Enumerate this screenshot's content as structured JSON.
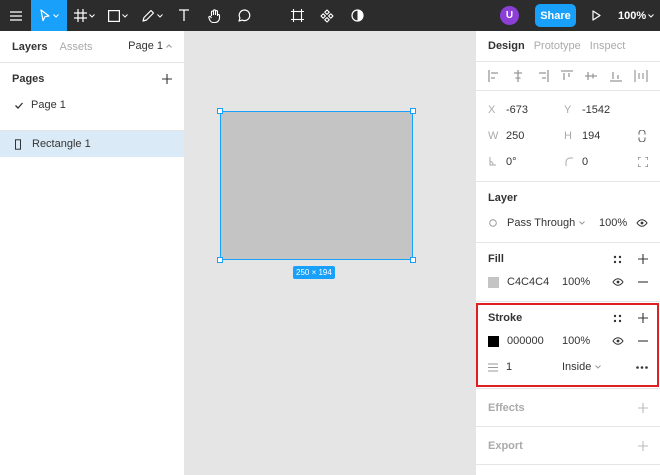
{
  "toolbar": {
    "user_initial": "U",
    "share_label": "Share",
    "zoom": "100%"
  },
  "left_panel": {
    "tab_layers": "Layers",
    "tab_assets": "Assets",
    "page_selector": "Page 1",
    "pages_title": "Pages",
    "pages": [
      {
        "label": "Page 1",
        "selected": true
      }
    ],
    "layers": [
      {
        "label": "Rectangle 1",
        "selected": true
      }
    ]
  },
  "canvas": {
    "size_label": "250 × 194"
  },
  "right_panel": {
    "tabs": [
      "Design",
      "Prototype",
      "Inspect"
    ],
    "x_key": "X",
    "x_value": "-673",
    "y_key": "Y",
    "y_value": "-1542",
    "w_key": "W",
    "w_value": "250",
    "h_key": "H",
    "h_value": "194",
    "rotation_value": "0°",
    "radius_value": "0",
    "layer": {
      "title": "Layer",
      "blend_mode": "Pass Through",
      "opacity": "100%"
    },
    "fill": {
      "title": "Fill",
      "hex": "C4C4C4",
      "opacity": "100%",
      "color": "#c4c4c4"
    },
    "stroke": {
      "title": "Stroke",
      "hex": "000000",
      "opacity": "100%",
      "color": "#000000",
      "weight": "1",
      "position": "Inside"
    },
    "effects_title": "Effects",
    "export_title": "Export"
  },
  "colors": {
    "accent": "#18a0fb",
    "toolbar_bg": "#2c2c2c",
    "avatar": "#8b3fd6",
    "highlight_border": "#e02020"
  }
}
